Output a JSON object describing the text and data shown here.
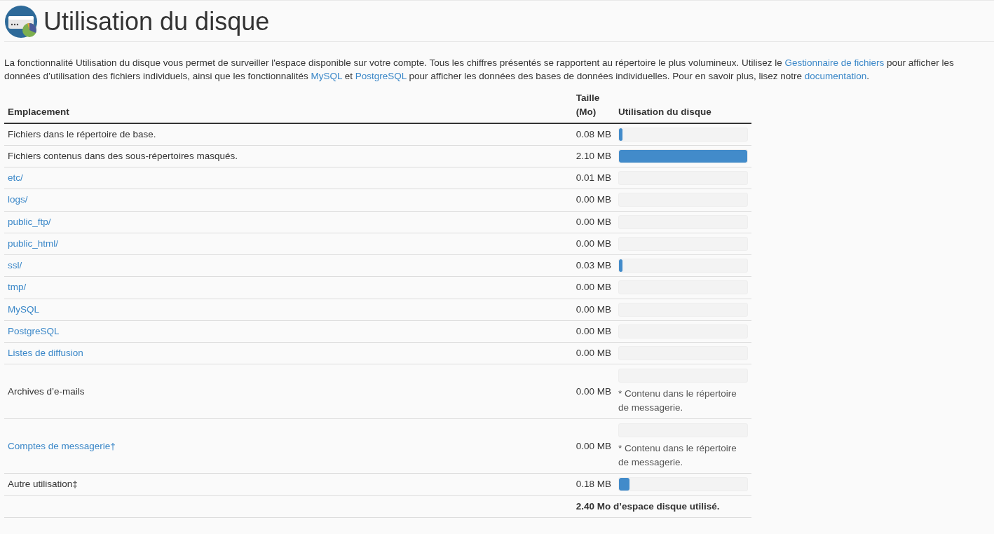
{
  "page": {
    "title": "Utilisation du disque"
  },
  "intro": [
    {
      "text": "La fonctionnalité Utilisation du disque vous permet de surveiller l'espace disponible sur votre compte. Tous les chiffres présentés se rapportent au répertoire le plus volumineux. Utilisez le ",
      "link": false
    },
    {
      "text": "Gestionnaire de fichiers",
      "link": true
    },
    {
      "text": " pour afficher les données d’utilisation des fichiers individuels, ainsi que les fonctionnalités ",
      "link": false
    },
    {
      "text": "MySQL",
      "link": true
    },
    {
      "text": " et ",
      "link": false
    },
    {
      "text": "PostgreSQL",
      "link": true
    },
    {
      "text": " pour afficher les données des bases de données individuelles. Pour en savoir plus, lisez notre ",
      "link": false
    },
    {
      "text": "documentation",
      "link": true
    },
    {
      "text": ".",
      "link": false
    }
  ],
  "table": {
    "columns": [
      "Emplacement",
      "Taille (Mo)",
      "Utilisation du disque"
    ],
    "rows": [
      {
        "location": "Fichiers dans le répertoire de base.",
        "link": false,
        "size": "0.08 MB",
        "level": 0.03
      },
      {
        "location": "Fichiers contenus dans des sous-répertoires masqués.",
        "link": false,
        "size": "2.10 MB",
        "level": 1
      },
      {
        "location": "etc/",
        "link": true,
        "size": "0.01 MB",
        "level": 0
      },
      {
        "location": "logs/",
        "link": true,
        "size": "0.00 MB",
        "level": 0
      },
      {
        "location": "public_ftp/",
        "link": true,
        "size": "0.00 MB",
        "level": 0
      },
      {
        "location": "public_html/",
        "link": true,
        "size": "0.00 MB",
        "level": 0
      },
      {
        "location": "ssl/",
        "link": true,
        "size": "0.03 MB",
        "level": 0.03
      },
      {
        "location": "tmp/",
        "link": true,
        "size": "0.00 MB",
        "level": 0
      },
      {
        "location": "MySQL",
        "link": true,
        "size": "0.00 MB",
        "level": 0
      },
      {
        "location": "PostgreSQL",
        "link": true,
        "size": "0.00 MB",
        "level": 0
      },
      {
        "location": "Listes de diffusion",
        "link": true,
        "size": "0.00 MB",
        "level": 0
      },
      {
        "location": "Archives d’e-mails",
        "link": false,
        "size": "0.00 MB",
        "level": 0,
        "note": "* Contenu dans le répertoire de messagerie."
      },
      {
        "location": "Comptes de messagerie†",
        "link": true,
        "size": "0.00 MB",
        "level": 0,
        "note": "* Contenu dans le répertoire de messagerie."
      },
      {
        "location": "Autre utilisation‡",
        "link": false,
        "size": "0.18 MB",
        "level": 0.08
      }
    ],
    "total": "2.40 Mo d’espace disque utilisé."
  }
}
